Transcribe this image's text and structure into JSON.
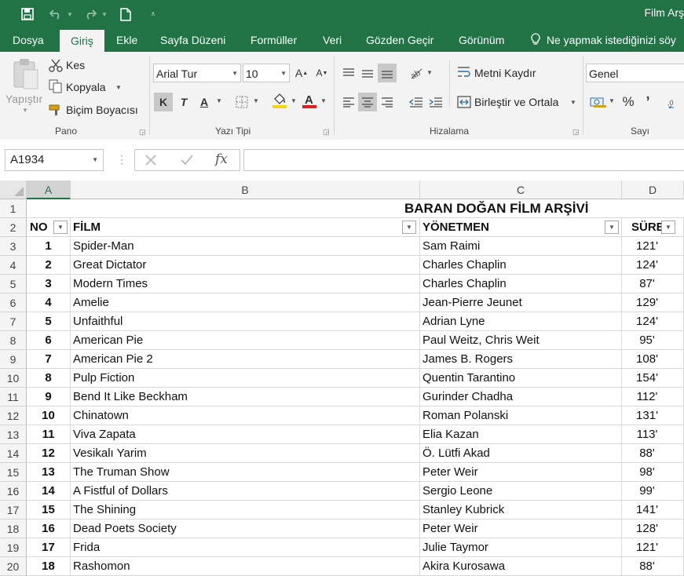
{
  "window": {
    "title": "Film Arş"
  },
  "quick_access": {
    "save": "save-icon",
    "undo": "undo-icon",
    "redo": "redo-icon",
    "new": "new-file-icon",
    "customize": "customize-icon"
  },
  "tabs": [
    {
      "label": "Dosya"
    },
    {
      "label": "Giriş",
      "active": true
    },
    {
      "label": "Ekle"
    },
    {
      "label": "Sayfa Düzeni"
    },
    {
      "label": "Formüller"
    },
    {
      "label": "Veri"
    },
    {
      "label": "Gözden Geçir"
    },
    {
      "label": "Görünüm"
    }
  ],
  "tell_me": "Ne yapmak istediğinizi söy",
  "ribbon": {
    "clipboard": {
      "paste": "Yapıştır",
      "cut": "Kes",
      "copy": "Kopyala",
      "format_painter": "Biçim Boyacısı",
      "group": "Pano"
    },
    "font": {
      "name": "Arial Tur",
      "size": "10",
      "bold": "K",
      "italic": "T",
      "underline": "A",
      "group": "Yazı Tipi",
      "fill_color": "#f5d40e",
      "font_color": "#e02020"
    },
    "alignment": {
      "wrap": "Metni Kaydır",
      "merge": "Birleştir ve Ortala",
      "group": "Hizalama"
    },
    "number": {
      "format": "Genel",
      "percent": "%",
      "comma": "’",
      "group": "Sayı"
    }
  },
  "formula_bar": {
    "name_box": "A1934",
    "fx": "fx",
    "value": ""
  },
  "grid": {
    "columns": [
      "A",
      "B",
      "C",
      "D"
    ],
    "title": "BARAN DOĞAN FİLM ARŞİVİ",
    "headers": {
      "no": "NO",
      "film": "FİLM",
      "director": "YÖNETMEN",
      "duration": "SÜRE"
    },
    "rows": [
      {
        "row": "3",
        "no": "1",
        "film": "Spider-Man",
        "director": "Sam Raimi",
        "duration": "121'"
      },
      {
        "row": "4",
        "no": "2",
        "film": "Great Dictator",
        "director": "Charles Chaplin",
        "duration": "124'"
      },
      {
        "row": "5",
        "no": "3",
        "film": "Modern Times",
        "director": "Charles Chaplin",
        "duration": "87'"
      },
      {
        "row": "6",
        "no": "4",
        "film": "Amelie",
        "director": "Jean-Pierre Jeunet",
        "duration": "129'"
      },
      {
        "row": "7",
        "no": "5",
        "film": "Unfaithful",
        "director": "Adrian Lyne",
        "duration": "124'"
      },
      {
        "row": "8",
        "no": "6",
        "film": "American Pie",
        "director": "Paul Weitz, Chris Weit",
        "duration": "95'"
      },
      {
        "row": "9",
        "no": "7",
        "film": "American Pie 2",
        "director": "James B. Rogers",
        "duration": "108'"
      },
      {
        "row": "10",
        "no": "8",
        "film": "Pulp Fiction",
        "director": "Quentin Tarantino",
        "duration": "154'"
      },
      {
        "row": "11",
        "no": "9",
        "film": "Bend It Like Beckham",
        "director": "Gurinder Chadha",
        "duration": "112'"
      },
      {
        "row": "12",
        "no": "10",
        "film": "Chinatown",
        "director": "Roman Polanski",
        "duration": "131'"
      },
      {
        "row": "13",
        "no": "11",
        "film": "Viva Zapata",
        "director": "Elia Kazan",
        "duration": "113'"
      },
      {
        "row": "14",
        "no": "12",
        "film": "Vesikalı Yarim",
        "director": "Ö. Lütfi Akad",
        "duration": "88'"
      },
      {
        "row": "15",
        "no": "13",
        "film": "The Truman Show",
        "director": "Peter Weir",
        "duration": "98'"
      },
      {
        "row": "16",
        "no": "14",
        "film": "A Fistful of Dollars",
        "director": "Sergio Leone",
        "duration": "99'"
      },
      {
        "row": "17",
        "no": "15",
        "film": "The Shining",
        "director": "Stanley Kubrick",
        "duration": "141'"
      },
      {
        "row": "18",
        "no": "16",
        "film": "Dead Poets Society",
        "director": "Peter Weir",
        "duration": "128'"
      },
      {
        "row": "19",
        "no": "17",
        "film": "Frida",
        "director": "Julie Taymor",
        "duration": "121'"
      },
      {
        "row": "20",
        "no": "18",
        "film": "Rashomon",
        "director": "Akira Kurosawa",
        "duration": "88'"
      }
    ]
  }
}
